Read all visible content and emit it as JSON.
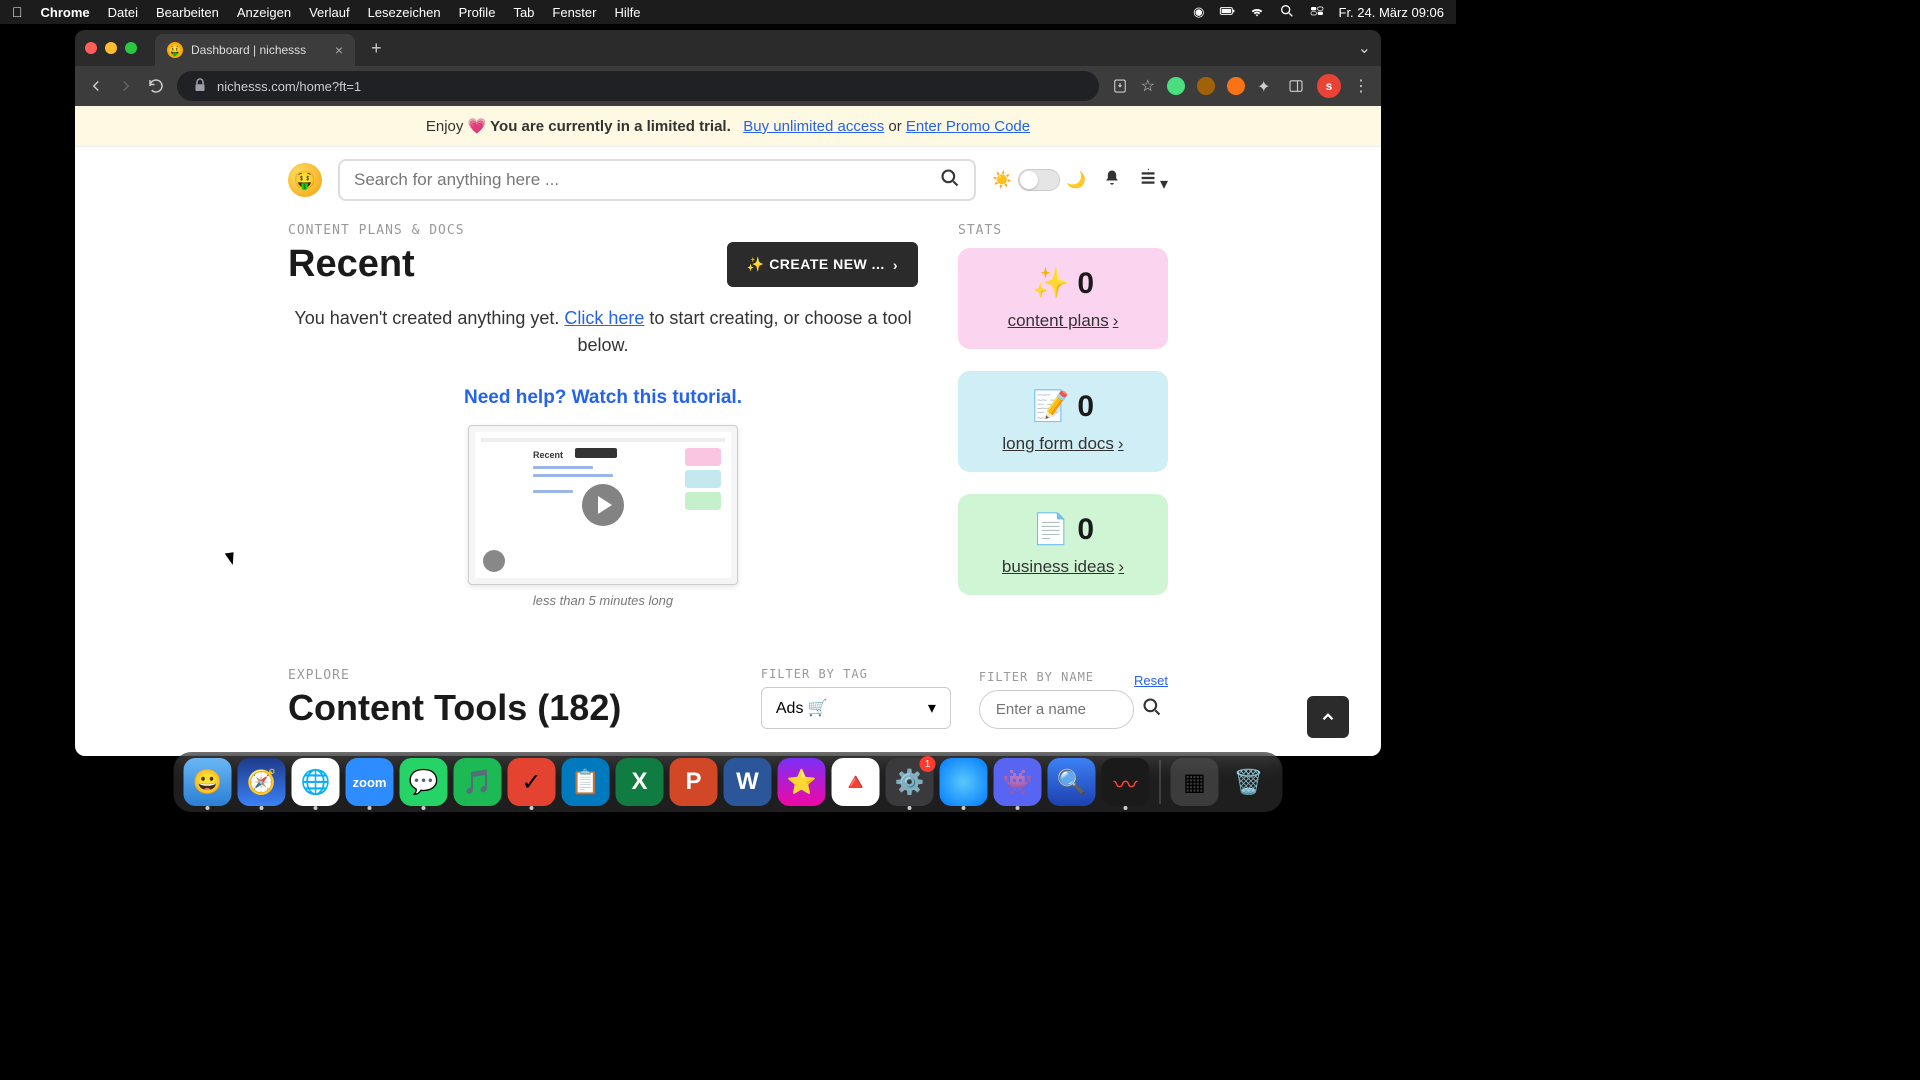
{
  "menubar": {
    "app": "Chrome",
    "items": [
      "Datei",
      "Bearbeiten",
      "Anzeigen",
      "Verlauf",
      "Lesezeichen",
      "Profile",
      "Tab",
      "Fenster",
      "Hilfe"
    ],
    "datetime": "Fr. 24. März  09:06"
  },
  "browser": {
    "tab_title": "Dashboard | nichesss",
    "url": "nichesss.com/home?ft=1",
    "avatar_letter": "s"
  },
  "banner": {
    "prefix": "Enjoy ",
    "emoji": "💗",
    "bold": " You are currently in a limited trial.",
    "link1": "Buy unlimited access",
    "mid": " or ",
    "link2": "Enter Promo Code"
  },
  "search": {
    "placeholder": "Search for anything here ..."
  },
  "section": {
    "eyebrow": "CONTENT PLANS & DOCS",
    "title": "Recent",
    "create_btn": "✨ CREATE NEW ...",
    "empty_pre": "You haven't created anything yet. ",
    "empty_link": "Click here",
    "empty_post": " to start creating, or choose a tool below.",
    "tutorial": "Need help? Watch this tutorial.",
    "video_caption": "less than 5 minutes long"
  },
  "stats": {
    "eyebrow": "STATS",
    "cards": [
      {
        "icon": "✨",
        "value": "0",
        "label": "content plans"
      },
      {
        "icon": "📝",
        "value": "0",
        "label": "long form docs"
      },
      {
        "icon": "📄",
        "value": "0",
        "label": "business ideas"
      }
    ]
  },
  "explore": {
    "eyebrow": "EXPLORE",
    "title": "Content Tools (182)",
    "filter_tag_label": "FILTER BY TAG",
    "filter_tag_value": "Ads 🛒",
    "filter_name_label": "FILTER BY NAME",
    "filter_name_placeholder": "Enter a name",
    "reset": "Reset"
  },
  "dock": {
    "badge": "1"
  }
}
